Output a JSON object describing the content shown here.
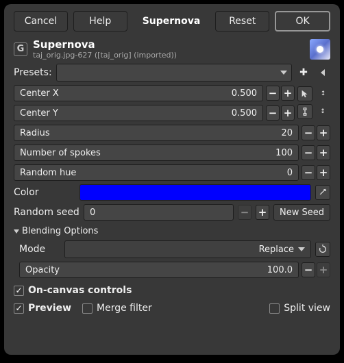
{
  "buttons": {
    "cancel": "Cancel",
    "help": "Help",
    "reset": "Reset",
    "ok": "OK"
  },
  "title": "Supernova",
  "header": {
    "title": "Supernova",
    "subtitle": "taj_orig.jpg-627 ([taj_orig] (imported))"
  },
  "presets": {
    "label": "Presets:"
  },
  "centerx": {
    "label": "Center X",
    "value": "0.500"
  },
  "centery": {
    "label": "Center Y",
    "value": "0.500"
  },
  "radius": {
    "label": "Radius",
    "value": "20"
  },
  "spokes": {
    "label": "Number of spokes",
    "value": "100"
  },
  "randhue": {
    "label": "Random hue",
    "value": "0"
  },
  "color": {
    "label": "Color",
    "value": "#0000ff"
  },
  "seed": {
    "label": "Random seed",
    "value": "0",
    "newseed": "New Seed"
  },
  "blending": {
    "section": "Blending Options",
    "mode_label": "Mode",
    "mode_value": "Replace",
    "opacity_label": "Opacity",
    "opacity_value": "100.0"
  },
  "checks": {
    "oncanvas": "On-canvas controls",
    "preview": "Preview",
    "merge": "Merge filter",
    "split": "Split view"
  }
}
